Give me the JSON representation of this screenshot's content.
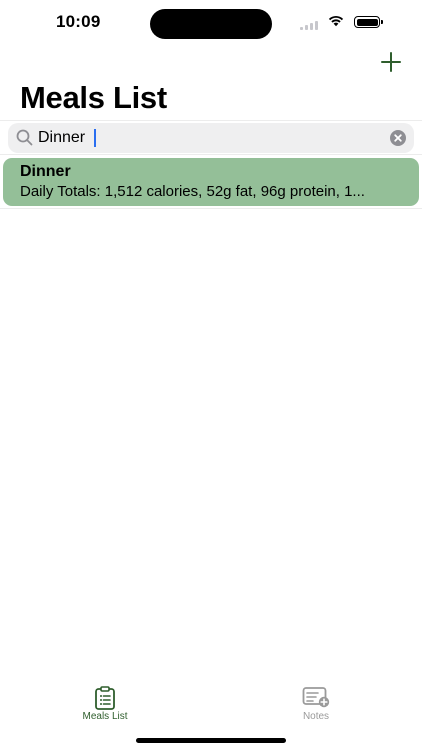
{
  "status_bar": {
    "time": "10:09",
    "wifi_icon": "wifi-icon",
    "battery_icon": "battery-full-icon",
    "signal_icon": "cell-signal-icon"
  },
  "nav": {
    "title": "Meals List",
    "add_icon": "plus-icon"
  },
  "search": {
    "value": "Dinner",
    "placeholder": "",
    "search_icon": "magnifying-glass-icon",
    "clear_icon": "clear-x-icon"
  },
  "meals": [
    {
      "name": "Dinner",
      "summary": "Daily Totals: 1,512 calories, 52g fat, 96g protein, 1..."
    }
  ],
  "tab_bar": {
    "tabs": [
      {
        "label": "Meals List",
        "icon": "clipboard-list-icon",
        "selected": true
      },
      {
        "label": "Notes",
        "icon": "note-add-icon",
        "selected": false
      }
    ]
  },
  "colors": {
    "accent": "#2f5e2d",
    "row_highlight": "#94bf98",
    "inactive_tab": "#9a9a9a",
    "search_background": "#efeff0",
    "cursor": "#2a6ef0"
  }
}
